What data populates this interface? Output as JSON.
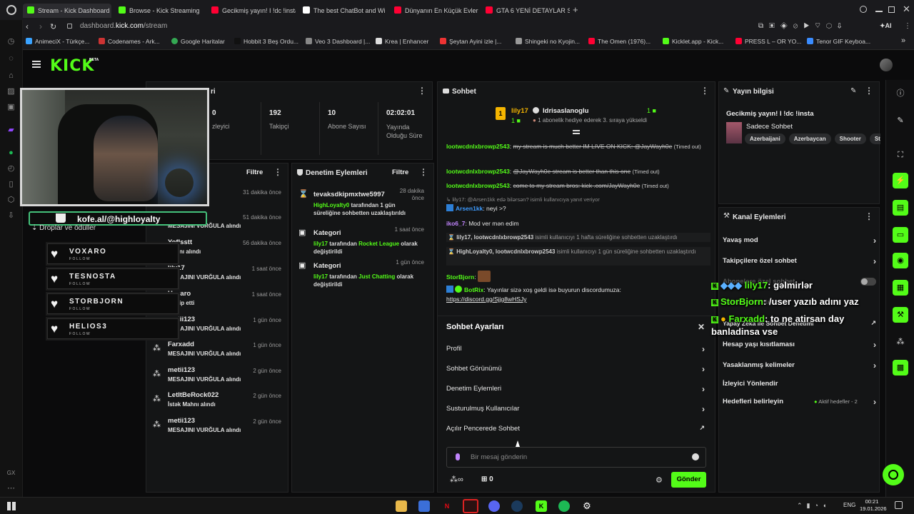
{
  "browser": {
    "tabs": [
      {
        "label": "Stream - Kick Dashboard",
        "color": "#53fc18"
      },
      {
        "label": "Browse - Kick Streaming",
        "color": "#53fc18"
      },
      {
        "label": "Gecikmiş yayın! I !dc !insta",
        "color": "#ff0033"
      },
      {
        "label": "The best ChatBot and Wi",
        "color": "#ffffff"
      },
      {
        "label": "Dünyanın En Küçük Evleri",
        "color": "#ff0033"
      },
      {
        "label": "GTA 6 YENİ DETAYLAR SIZ",
        "color": "#ff0033"
      }
    ],
    "new_tab": "+",
    "url_host": "dashboard.",
    "url_domain": "kick.com",
    "url_path": "/stream",
    "ai_label": "AI",
    "bookmarks": [
      {
        "label": "AnimeciX - Türkçe...",
        "color": "#3aa3ff"
      },
      {
        "label": "Codenames - Ark...",
        "color": "#c33"
      },
      {
        "label": "Google Haritalar",
        "color": "#34a853"
      },
      {
        "label": "Hobbit 3 Beş Ordu...",
        "color": "#111"
      },
      {
        "label": "Veo 3 Dashboard |...",
        "color": "#888"
      },
      {
        "label": "Krea | Enhancer",
        "color": "#ddd"
      },
      {
        "label": "Şeytan Ayini izle |...",
        "color": "#e33"
      },
      {
        "label": "Shingeki no Kyojin...",
        "color": "#999"
      },
      {
        "label": "The Omen (1976)...",
        "color": "#ff0033"
      },
      {
        "label": "Kicklet.app - Kick...",
        "color": "#53fc18"
      },
      {
        "label": "PRESS L – OR YO...",
        "color": "#ff0033"
      },
      {
        "label": "Tenor GIF Keyboa...",
        "color": "#3a8cff"
      }
    ]
  },
  "nav": {
    "logo": "KICK",
    "logo_badge": "BETA"
  },
  "stats": {
    "title_partial": "ri",
    "items": [
      {
        "value": "0",
        "label": "zleyici"
      },
      {
        "value": "192",
        "label": "Takipçi"
      },
      {
        "value": "10",
        "label": "Abone Sayısı"
      },
      {
        "value": "02:02:01",
        "label": "Yayında Olduğu Süre"
      }
    ]
  },
  "activity": {
    "filter": "Filtre",
    "items": [
      {
        "name": "",
        "sub": "",
        "time": "31 dakika önce"
      },
      {
        "name": "",
        "sub": "MESAJINI VURĞULA alındı",
        "time": "51 dakika önce"
      },
      {
        "name": "Yoflsstt",
        "sub": "Mahnı alındı",
        "time": "56 dakika önce"
      },
      {
        "name": "lily17",
        "sub": "MESAJINI VURĞULA alındı",
        "time": "1 saat önce"
      },
      {
        "name": "Havaro",
        "sub": "ı takip etti",
        "time": "1 saat önce"
      },
      {
        "name": "metii123",
        "sub": "MESAJINI VURĞULA alındı",
        "time": "1 gün önce"
      },
      {
        "name": "Farxadd",
        "sub": "MESAJINI VURĞULA alındı",
        "time": "1 gün önce"
      },
      {
        "name": "metii123",
        "sub": "MESAJINI VURĞULA alındı",
        "time": "2 gün önce"
      },
      {
        "name": "LetItBeRock022",
        "sub": "İstək Mahnı alındı",
        "time": "2 gün önce"
      },
      {
        "name": "metii123",
        "sub": "MESAJINI VURĞULA alındı",
        "time": "2 gün önce"
      }
    ]
  },
  "moderation": {
    "title": "Denetim Eylemleri",
    "filter": "Filtre",
    "items": [
      {
        "title": "tevaksdkipmxtwe5997",
        "time": "28 dakika önce",
        "actor": "HighLoyalty0",
        "text": " tarafından 1 gün süreliğine sohbetten uzaklaştırıldı"
      },
      {
        "title": "Kategori",
        "time": "1 saat önce",
        "actor": "lily17",
        "text": " tarafından ",
        "target": "Rocket League",
        "tail": " olarak değiştirildi"
      },
      {
        "title": "Kategori",
        "time": "1 gün önce",
        "actor": "lily17",
        "text": " tarafından ",
        "target": "Just Chatting",
        "tail": " olarak değiştirildi"
      }
    ]
  },
  "chat": {
    "title": "Sohbet",
    "pinned_left_name": "lily17",
    "pinned_left_count": "1",
    "pinned_right_name": "Idrisaslanoglu",
    "pinned_right_count": "1",
    "pinned_text": "1 abonelik hediye ederek 3. sıraya yükseldi",
    "messages": [
      {
        "user": "lootwcdnlxbrowp2543",
        "text": "my stream is much better IM LIVE ON KICK: @JayWayh0e",
        "note": "(Timed out)"
      },
      {
        "user": "HighLoyalty0",
        "text": "",
        "note": ""
      },
      {
        "user": "lootwcdnlxbrowp2543",
        "text": "@JayWayh0e stream is better than this one",
        "note": "(Timed out)"
      },
      {
        "user": "lootwcdnlxbrowp2543",
        "text": "come to my stream bros: kick .com/JayWayh0e",
        "note": "(Timed out)"
      }
    ],
    "reply_hint": "lily17: @Arsen1kk edə bilərsən? isimli kullanıcıya yanıt veriyor",
    "arsen_user": "Arsen1kk",
    "arsen_text": "neyi >?",
    "iko_user": "iko6_7",
    "iko_text": "Mod ver mən edim",
    "sys1_who": "lily17, lootwcdnlxbrowp2543",
    "sys1_text": " isimli kullanıcıyı 1 hafta süreliğine sohbetten uzaklaştırdı",
    "sys2_who": "HighLoyalty0, lootwcdnlxbrowp2543",
    "sys2_text": " isimli kullanıcıyı 1 gün süreliğine sohbetten uzaklaştırdı",
    "storb_user": "StorBjorn",
    "botrix_user": "BotRix",
    "botrix_text": "Yayınlar sizə xoş gəldi isə buyurun discordumuza:",
    "botrix_link": "https://discord.gg/Sjjg8wHSJy",
    "settings_title": "Sohbet Ayarları",
    "settings_items": [
      "Profil",
      "Sohbet Görünümü",
      "Denetim Eylemleri",
      "Susturulmuş Kullanıcılar",
      "Açılır Pencerede Sohbet"
    ],
    "input_placeholder": "Bir mesaj gönderin",
    "points": "∞",
    "gift_count": "0",
    "send": "Gönder"
  },
  "stream_info": {
    "title": "Yayın bilgisi",
    "stream_title": "Gecikmiş yayın! I !dc !insta",
    "category": "Sadece Sohbet",
    "tags": [
      "Azerbaijani",
      "Azerbaycan",
      "Shooter",
      "St"
    ]
  },
  "channel_actions": {
    "title": "Kanal Eylemleri",
    "items": [
      "Yavaş mod",
      "Takipçilere özel sohbet",
      "Abonelere özel sohbet",
      "Yalnızca emote",
      "Yapay Zeka ile Sohbet Denetimi",
      "Hesap yaşı kısıtlaması",
      "Yasaklanmış kelimeler",
      "İzleyici Yönlendir",
      "Hedefleri belirleyin"
    ],
    "goals_status": "Aktif hedefler - 2"
  },
  "overlay": {
    "kofi": "kofe.al/@highloyalty",
    "drops": "Droplar ve ödüller",
    "followers": [
      {
        "name": "VOXARO",
        "label": "FOLLOW"
      },
      {
        "name": "TESNOSTA",
        "label": "FOLLOW"
      },
      {
        "name": "STORBJORN",
        "label": "FOLLOW"
      },
      {
        "name": "HELIOS3",
        "label": "FOLLOW"
      }
    ],
    "chat_overlay": [
      {
        "name": "lily17",
        "text": ": gəlmirlər"
      },
      {
        "name": "StorBjorn",
        "text": ": /user yazıb adını yaz"
      },
      {
        "name": "Farxadd",
        "text": ": to ne atirsan day banladinsa vse"
      }
    ]
  },
  "taskbar": {
    "lang": "ENG",
    "time": "00:21",
    "date": "19.01.2026"
  }
}
